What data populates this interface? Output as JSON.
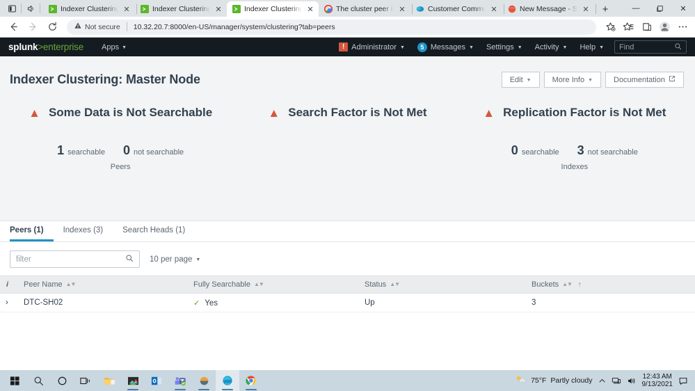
{
  "browser": {
    "tabs": [
      {
        "title": "Indexer Clustering | S",
        "favicon": "splunk-icon",
        "active": false
      },
      {
        "title": "Indexer Clustering | S",
        "favicon": "splunk-icon",
        "active": false
      },
      {
        "title": "Indexer Clustering | S",
        "favicon": "splunk-icon",
        "active": true
      },
      {
        "title": "The cluster peer is un",
        "favicon": "google-icon",
        "active": false
      },
      {
        "title": "Customer Communit",
        "favicon": "community-icon",
        "active": false
      },
      {
        "title": "New Message - Splu",
        "favicon": "message-icon",
        "active": false
      }
    ],
    "new_tab_label": "+",
    "window_controls": {
      "minimize": "—",
      "maximize": "❐",
      "close": "✕"
    },
    "toolbar": {
      "back_label": "←",
      "forward_label": "→",
      "reload_label": "↻",
      "security_label": "Not secure",
      "url": "10.32.20.7:8000/en-US/manager/system/clustering?tab=peers",
      "icons": [
        "add-favorite-icon",
        "favorites-icon",
        "collections-icon",
        "profile-icon",
        "settings-more-icon"
      ]
    }
  },
  "splunk_header": {
    "logo_word": "splunk",
    "logo_suffix": ">enterprise",
    "apps_label": "Apps",
    "alert_glyph": "!",
    "user_label": "Administrator",
    "messages_count": "5",
    "messages_label": "Messages",
    "settings_label": "Settings",
    "activity_label": "Activity",
    "help_label": "Help",
    "find_placeholder": "Find",
    "accent_green": "#65a637",
    "accent_blue": "#1e93c6",
    "accent_red": "#d6563c"
  },
  "page": {
    "title": "Indexer Clustering: Master Node",
    "actions": [
      {
        "label": "Edit",
        "caret": true,
        "external": false
      },
      {
        "label": "More Info",
        "caret": true,
        "external": false
      },
      {
        "label": "Documentation",
        "caret": false,
        "external": true
      }
    ],
    "warnings": [
      {
        "text": "Some Data is Not Searchable",
        "icon": "warning-triangle-icon"
      },
      {
        "text": "Search Factor is Not Met",
        "icon": "warning-triangle-icon"
      },
      {
        "text": "Replication Factor is Not Met",
        "icon": "warning-triangle-icon"
      }
    ],
    "stats": [
      {
        "group": "Peers",
        "searchable_count": "1",
        "searchable_label": "searchable",
        "not_searchable_count": "0",
        "not_searchable_label": "not searchable"
      },
      {
        "group": "Indexes",
        "searchable_count": "0",
        "searchable_label": "searchable",
        "not_searchable_count": "3",
        "not_searchable_label": "not searchable"
      }
    ]
  },
  "tabs": [
    {
      "label": "Peers (1)",
      "active": true
    },
    {
      "label": "Indexes (3)",
      "active": false
    },
    {
      "label": "Search Heads (1)",
      "active": false
    }
  ],
  "toolbar": {
    "filter_placeholder": "filter",
    "filter_value": "",
    "per_page_label": "10 per page"
  },
  "table": {
    "columns": [
      {
        "label": "i",
        "sortable": false,
        "dagger": false
      },
      {
        "label": "Peer Name",
        "sortable": true,
        "dagger": false
      },
      {
        "label": "Fully Searchable",
        "sortable": true,
        "dagger": false
      },
      {
        "label": "Status",
        "sortable": true,
        "dagger": false
      },
      {
        "label": "Buckets",
        "sortable": true,
        "dagger": true
      }
    ],
    "rows": [
      {
        "expander": "›",
        "peer_name": "DTC-SH02",
        "fully_searchable": "Yes",
        "fully_searchable_check": "✓",
        "status": "Up",
        "buckets": "3"
      }
    ]
  },
  "taskbar": {
    "apps": [
      {
        "name": "start-button",
        "focused": false,
        "running": false
      },
      {
        "name": "search-icon",
        "focused": false,
        "running": false
      },
      {
        "name": "cortana-icon",
        "focused": false,
        "running": false
      },
      {
        "name": "task-view-icon",
        "focused": false,
        "running": false
      },
      {
        "name": "file-explorer-icon",
        "focused": false,
        "running": false
      },
      {
        "name": "photos-icon",
        "focused": false,
        "running": true
      },
      {
        "name": "outlook-icon",
        "focused": false,
        "running": false
      },
      {
        "name": "teams-icon",
        "focused": false,
        "running": true
      },
      {
        "name": "generic-app-icon",
        "focused": false,
        "running": true
      },
      {
        "name": "edge-icon",
        "focused": true,
        "running": true
      },
      {
        "name": "chrome-icon",
        "focused": false,
        "running": true
      }
    ],
    "tray": {
      "weather_temp": "75°F",
      "weather_desc": "Partly cloudy",
      "chevron": "∧",
      "time": "12:43 AM",
      "date": "9/13/2021"
    }
  }
}
